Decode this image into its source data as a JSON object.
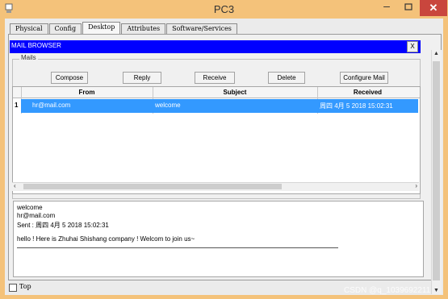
{
  "window": {
    "title": "PC3"
  },
  "tabs": [
    "Physical",
    "Config",
    "Desktop",
    "Attributes",
    "Software/Services"
  ],
  "mail_browser": {
    "title": "MAIL BROWSER",
    "close_label": "X",
    "mails_group_label": "Mails",
    "buttons": {
      "compose": "Compose",
      "reply": "Reply",
      "receive": "Receive",
      "delete": "Delete",
      "configure": "Configure Mail"
    },
    "table": {
      "columns": [
        "From",
        "Subject",
        "Received"
      ],
      "rows": [
        {
          "num": "1",
          "from": "hr@mail.com",
          "subject": "welcome",
          "received": "周四 4月 5 2018 15:02:31"
        }
      ]
    },
    "preview": {
      "subject": "welcome",
      "from": "hr@mail.com",
      "sent": "Sent : 周四 4月 5 2018 15:02:31",
      "body": "hello ! Here is Zhuhai Shishang company ! Welcom to join us~"
    }
  },
  "footer": {
    "top_label": "Top"
  },
  "watermark": "CSDN @q_1039692211",
  "colors": {
    "titlebar": "#f4c27a",
    "header": "#0000ff",
    "selection": "#3399ff",
    "close": "#c9463d"
  }
}
